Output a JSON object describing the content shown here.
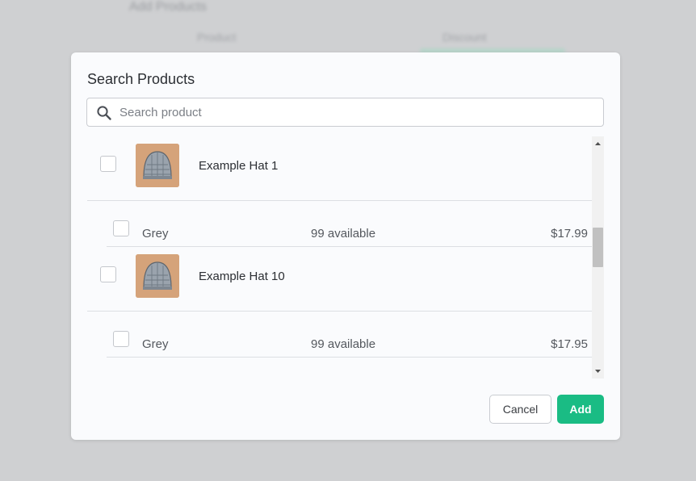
{
  "background": {
    "title": "Add Products",
    "columns": [
      "Product",
      "Discount"
    ]
  },
  "modal": {
    "title": "Search Products",
    "search": {
      "placeholder": "Search product",
      "value": ""
    },
    "products": [
      {
        "name": "Example Hat 1",
        "variants": [
          {
            "name": "Grey",
            "availability": "99 available",
            "price": "$17.99"
          }
        ]
      },
      {
        "name": "Example Hat 10",
        "variants": [
          {
            "name": "Grey",
            "availability": "99 available",
            "price": "$17.95"
          }
        ]
      }
    ],
    "cancel_label": "Cancel",
    "add_label": "Add"
  },
  "colors": {
    "accent": "#1abc84",
    "overlay": "#cfd0d2",
    "modal_bg": "#fafbfd"
  },
  "icons": {
    "search": "search-icon",
    "product_thumb": "hat-image"
  }
}
